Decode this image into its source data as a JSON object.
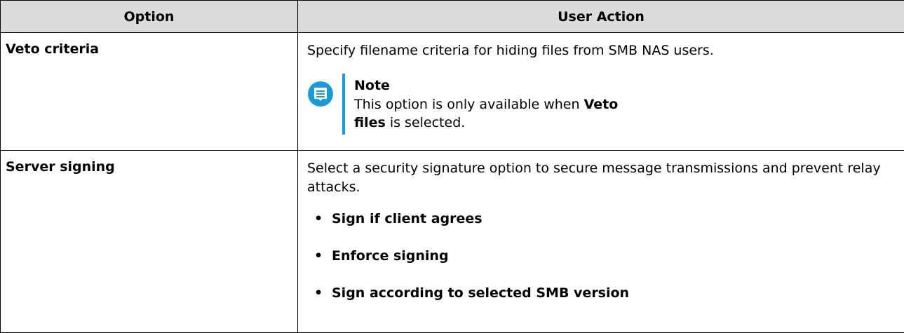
{
  "header": {
    "option": "Option",
    "user_action": "User Action"
  },
  "rows": [
    {
      "option": "Veto criteria",
      "action": "Specify filename criteria for hiding files from SMB NAS users.",
      "note": {
        "icon": "note-speech-bubble-icon",
        "title": "Note",
        "text_before": "This option is only available when ",
        "text_bold": "Veto files",
        "text_after": " is selected."
      }
    },
    {
      "option": "Server signing",
      "action": "Select a security signature option to secure message transmissions and prevent relay attacks.",
      "bullets": [
        "Sign if client agrees",
        "Enforce signing",
        "Sign according to selected SMB version"
      ]
    }
  ],
  "colors": {
    "header_bg": "#dcdcdc",
    "accent": "#1a9bd7"
  }
}
